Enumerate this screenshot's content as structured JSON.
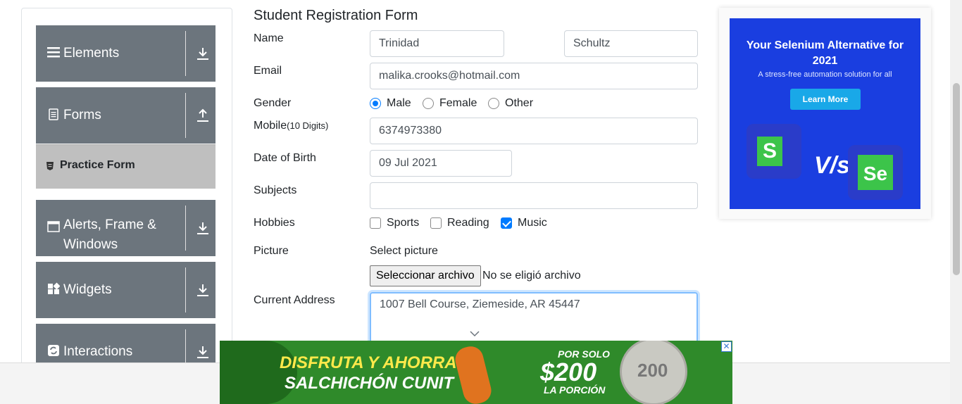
{
  "sidebar": {
    "groups": [
      {
        "label": "Elements",
        "icon": "hamburger-icon",
        "chevron": "download-arrow-icon"
      },
      {
        "label": "Forms",
        "icon": "document-icon",
        "chevron": "upload-arrow-icon"
      },
      {
        "label": "Alerts, Frame &",
        "label2": "Windows",
        "icon": "window-icon",
        "chevron": "download-arrow-icon"
      },
      {
        "label": "Widgets",
        "icon": "widgets-icon",
        "chevron": "download-arrow-icon"
      },
      {
        "label": "Interactions",
        "icon": "interactions-icon",
        "chevron": "download-arrow-icon"
      }
    ],
    "active_item": "Practice Form"
  },
  "form": {
    "title": "Student Registration Form",
    "name_label": "Name",
    "first_name": "Trinidad",
    "last_name": "Schultz",
    "email_label": "Email",
    "email": "malika.crooks@hotmail.com",
    "gender_label": "Gender",
    "gender_options": [
      "Male",
      "Female",
      "Other"
    ],
    "gender_selected": "Male",
    "mobile_label": "Mobile",
    "mobile_hint": "(10 Digits)",
    "mobile": "6374973380",
    "dob_label": "Date of Birth",
    "dob": "09 Jul 2021",
    "subjects_label": "Subjects",
    "subjects": "",
    "hobbies_label": "Hobbies",
    "hobbies": [
      {
        "label": "Sports",
        "checked": false
      },
      {
        "label": "Reading",
        "checked": false
      },
      {
        "label": "Music",
        "checked": true
      }
    ],
    "picture_label": "Picture",
    "picture_caption": "Select picture",
    "file_button": "Seleccionar archivo",
    "file_status": "No se eligió archivo",
    "address_label": "Current Address",
    "address": "1007 Bell Course, Ziemeside, AR 45447"
  },
  "ad_right": {
    "headline": "Your Selenium Alternative for 2021",
    "sub": "A stress-free automation solution for all",
    "button": "Learn More",
    "vs": "V/s",
    "logo_left": "S",
    "logo_right": "Se"
  },
  "ad_bottom": {
    "line1": "DISFRUTA Y AHORRA",
    "line2": "SALCHICHÓN CUNIT",
    "line3": "POR SOLO",
    "price": "$200",
    "line5": "LA PORCIÓN",
    "coin": "200",
    "close": "✕"
  },
  "colors": {
    "sidebar": "#6c757d",
    "active": "#bfbfbf",
    "accent": "#007bff",
    "ad_blue": "#1a3ee0",
    "ad_green": "#2f8a2a"
  }
}
